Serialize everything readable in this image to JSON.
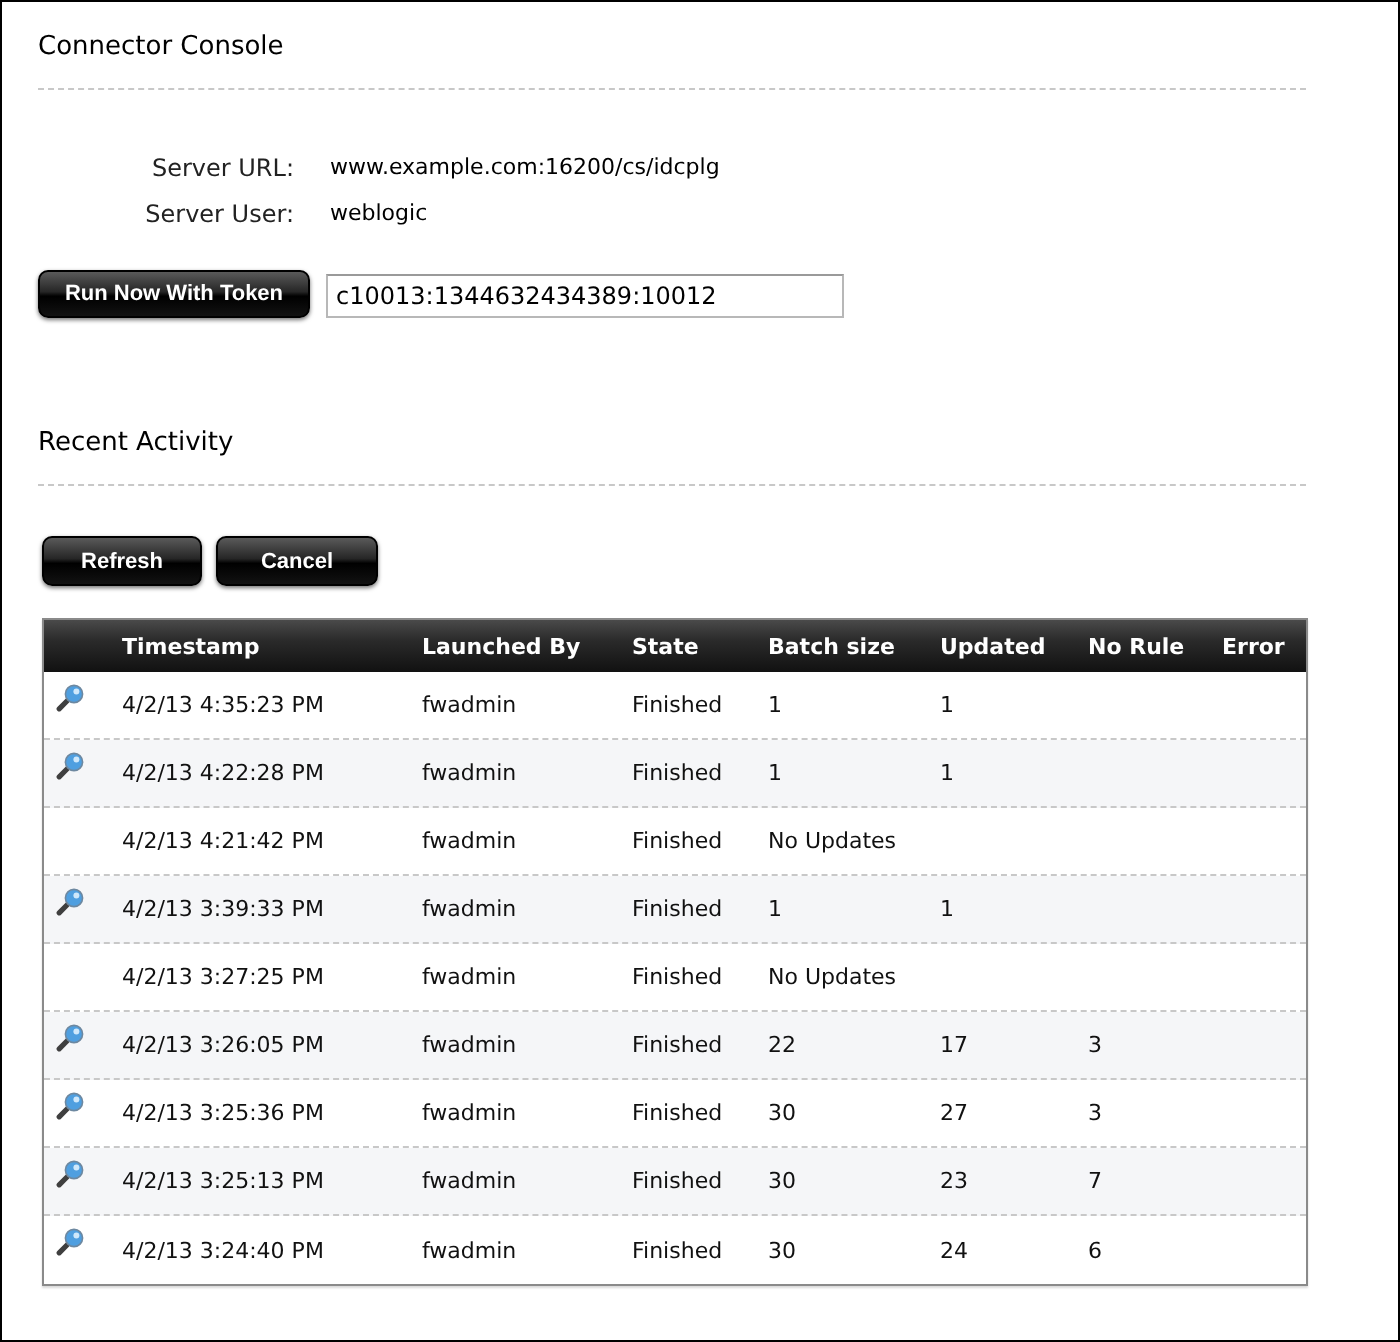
{
  "title": "Connector Console",
  "server": [
    {
      "label": "Server URL:",
      "value": "www.example.com:16200/cs/idcplg"
    },
    {
      "label": "Server User:",
      "value": "weblogic"
    }
  ],
  "run_button": "Run Now With Token",
  "token_field": {
    "value": "c10013:1344632434389:10012"
  },
  "recent_activity": {
    "title": "Recent Activity",
    "buttons": [
      "Refresh",
      "Cancel"
    ],
    "table": {
      "columns": [
        "Timestamp",
        "Launched By",
        "State",
        "Batch size",
        "Updated",
        "No Rule",
        "Error"
      ],
      "rows": [
        {
          "details": true,
          "cells": [
            "4/2/13 4:35:23 PM",
            "fwadmin",
            "Finished",
            "1",
            "1"
          ]
        },
        {
          "details": true,
          "cells": [
            "4/2/13 4:22:28 PM",
            "fwadmin",
            "Finished",
            "1",
            "1"
          ]
        },
        {
          "details": false,
          "cells": [
            "4/2/13 4:21:42 PM",
            "fwadmin",
            "Finished",
            "No Updates"
          ]
        },
        {
          "details": true,
          "cells": [
            "4/2/13 3:39:33 PM",
            "fwadmin",
            "Finished",
            "1",
            "1"
          ]
        },
        {
          "details": false,
          "cells": [
            "4/2/13 3:27:25 PM",
            "fwadmin",
            "Finished",
            "No Updates"
          ]
        },
        {
          "details": true,
          "cells": [
            "4/2/13 3:26:05 PM",
            "fwadmin",
            "Finished",
            "22",
            "17",
            "3"
          ]
        },
        {
          "details": true,
          "cells": [
            "4/2/13 3:25:36 PM",
            "fwadmin",
            "Finished",
            "30",
            "27",
            "3"
          ]
        },
        {
          "details": true,
          "cells": [
            "4/2/13 3:25:13 PM",
            "fwadmin",
            "Finished",
            "30",
            "23",
            "7"
          ]
        },
        {
          "details": true,
          "cells": [
            "4/2/13 3:24:40 PM",
            "fwadmin",
            "Finished",
            "30",
            "24",
            "6"
          ]
        }
      ]
    }
  }
}
